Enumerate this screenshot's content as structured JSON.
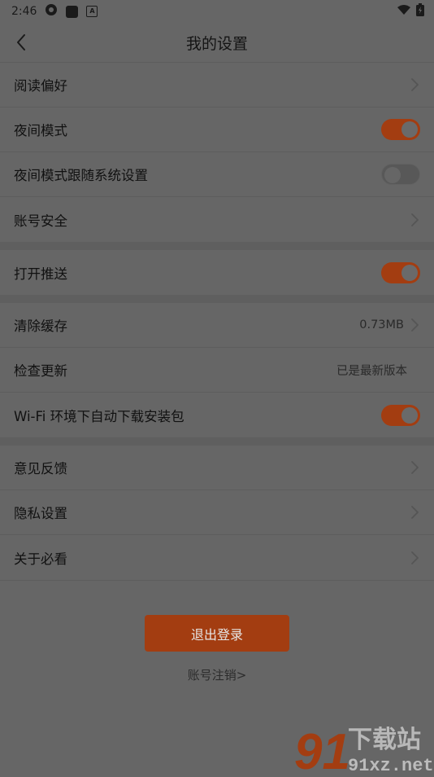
{
  "status_bar": {
    "time": "2:46"
  },
  "header": {
    "title": "我的设置"
  },
  "groups": [
    {
      "rows": [
        {
          "label": "阅读偏好",
          "control": "chevron"
        },
        {
          "label": "夜间模式",
          "control": "toggle",
          "on": true
        },
        {
          "label": "夜间模式跟随系统设置",
          "control": "toggle",
          "on": false
        },
        {
          "label": "账号安全",
          "control": "chevron"
        }
      ]
    },
    {
      "rows": [
        {
          "label": "打开推送",
          "control": "toggle",
          "on": true
        }
      ]
    },
    {
      "rows": [
        {
          "label": "清除缓存",
          "value": "0.73MB",
          "control": "chevron"
        },
        {
          "label": "检查更新",
          "value": "已是最新版本",
          "control": "none"
        },
        {
          "label": "Wi-Fi 环境下自动下载安装包",
          "control": "toggle",
          "on": true
        }
      ]
    },
    {
      "rows": [
        {
          "label": "意见反馈",
          "control": "chevron"
        },
        {
          "label": "隐私设置",
          "control": "chevron"
        },
        {
          "label": "关于必看",
          "control": "chevron"
        }
      ]
    }
  ],
  "footer": {
    "logout_label": "退出登录",
    "cancel_account_label": "账号注销>"
  },
  "watermark": {
    "brand": "下载站",
    "site": "91xz.net",
    "logo_text": "91"
  },
  "colors": {
    "accent": "#a33d11",
    "background": "#666666"
  }
}
